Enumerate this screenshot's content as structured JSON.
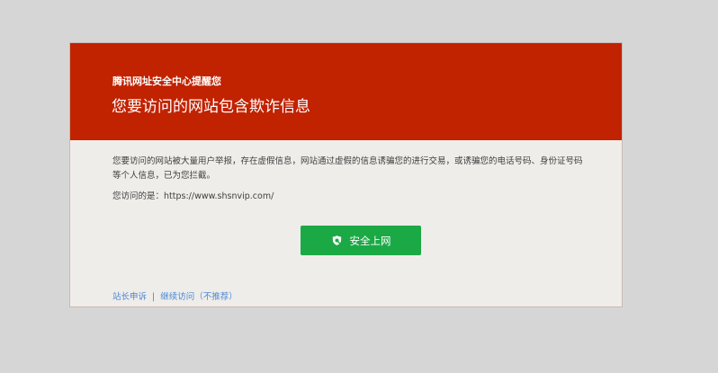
{
  "warning": {
    "brand_line": "腾讯网址安全中心提醒您",
    "title": "您要访问的网站包含欺诈信息",
    "description": "您要访问的网站被大量用户举报，存在虚假信息，网站通过虚假的信息诱骗您的进行交易，或诱骗您的电话号码、身份证号码等个人信息，已为您拦截。",
    "url_label": "您访问的是：",
    "url": "https://www.shsnvip.com/",
    "safe_button_label": "安全上网",
    "safe_button_icon": "shield-check-icon",
    "footer_links": {
      "appeal": "站长申诉",
      "separator": "|",
      "continue": "继续访问（不推荐）"
    }
  },
  "colors": {
    "page_background": "#d6d6d6",
    "header_red": "#c12200",
    "card_background": "#efedea",
    "button_green": "#1ba945",
    "link_blue": "#4a88d4",
    "body_text": "#3f3f3f"
  }
}
